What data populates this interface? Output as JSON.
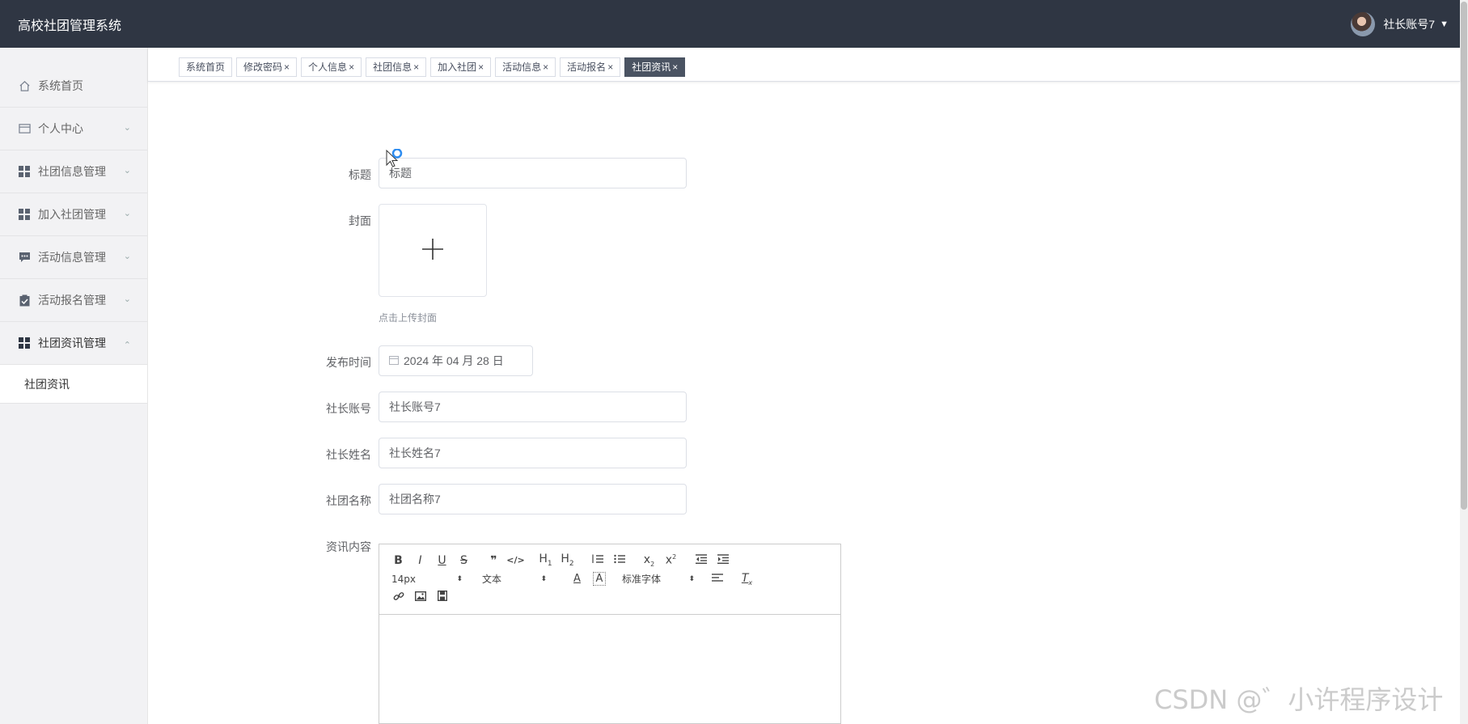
{
  "app": {
    "title": "高校社团管理系统",
    "user_name": "社长账号7"
  },
  "sidebar": {
    "items": [
      {
        "label": "系统首页",
        "icon": "home-icon"
      },
      {
        "label": "个人中心",
        "icon": "id-card-icon",
        "expanded": false
      },
      {
        "label": "社团信息管理",
        "icon": "grid-icon",
        "expanded": false
      },
      {
        "label": "加入社团管理",
        "icon": "grid-icon",
        "expanded": false
      },
      {
        "label": "活动信息管理",
        "icon": "chat-icon",
        "expanded": false
      },
      {
        "label": "活动报名管理",
        "icon": "clipboard-check-icon",
        "expanded": false
      },
      {
        "label": "社团资讯管理",
        "icon": "grid-icon",
        "expanded": true
      }
    ],
    "submenu": [
      {
        "label": "社团资讯"
      }
    ]
  },
  "tabs": [
    {
      "label": "系统首页",
      "closable": false
    },
    {
      "label": "修改密码",
      "closable": true
    },
    {
      "label": "个人信息",
      "closable": true
    },
    {
      "label": "社团信息",
      "closable": true
    },
    {
      "label": "加入社团",
      "closable": true
    },
    {
      "label": "活动信息",
      "closable": true
    },
    {
      "label": "活动报名",
      "closable": true
    },
    {
      "label": "社团资讯",
      "closable": true,
      "active": true
    }
  ],
  "tab_close_glyph": "×",
  "form": {
    "title_label": "标题",
    "title_value": "标题",
    "cover_label": "封面",
    "cover_tip": "点击上传封面",
    "publish_time_label": "发布时间",
    "publish_time_value": "2024 年 04 月 28 日",
    "leader_account_label": "社长账号",
    "leader_account_value": "社长账号7",
    "leader_name_label": "社长姓名",
    "leader_name_value": "社长姓名7",
    "club_name_label": "社团名称",
    "club_name_value": "社团名称7",
    "content_label": "资讯内容"
  },
  "editor": {
    "font_size": "14px",
    "header_type": "文本",
    "font_family": "标准字体"
  },
  "watermark": "CSDN @゛小许程序设计",
  "colors": {
    "topbar": "#2f3643",
    "active_tab": "#4a5362",
    "sidebar_bg": "#f2f2f4"
  }
}
